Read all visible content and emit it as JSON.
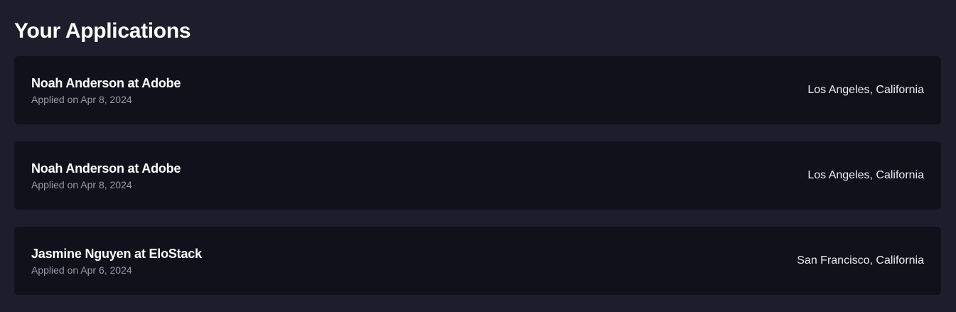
{
  "page": {
    "title": "Your Applications"
  },
  "applications": [
    {
      "title": "Noah Anderson at Adobe",
      "applied": "Applied on Apr 8, 2024",
      "location": "Los Angeles, California"
    },
    {
      "title": "Noah Anderson at Adobe",
      "applied": "Applied on Apr 8, 2024",
      "location": "Los Angeles, California"
    },
    {
      "title": "Jasmine Nguyen at EloStack",
      "applied": "Applied on Apr 6, 2024",
      "location": "San Francisco, California"
    }
  ],
  "colors": {
    "background": "#1e1d2b",
    "card": "#11111c",
    "muted_text": "#9a9aa6"
  }
}
